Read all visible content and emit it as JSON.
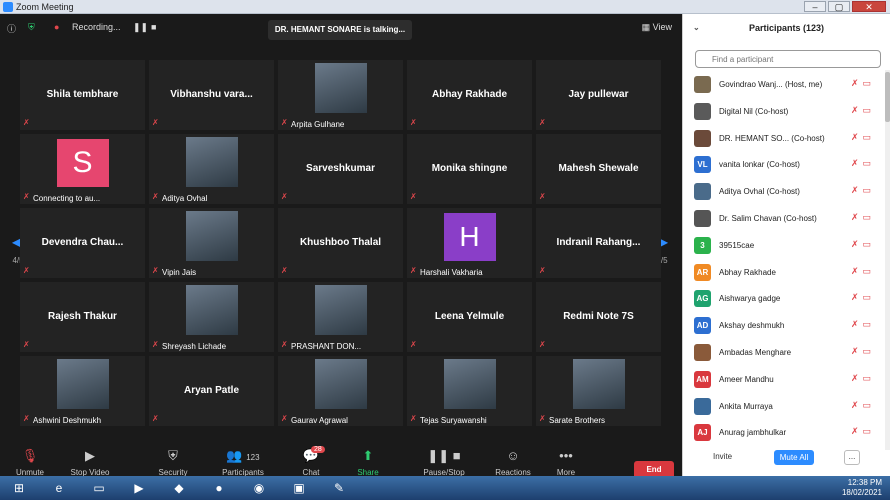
{
  "window": {
    "title": "Zoom Meeting"
  },
  "topbar": {
    "recording": "Recording...",
    "talking": "DR. HEMANT SONARE is talking...",
    "view": "View"
  },
  "grid": {
    "page_left": "4/5",
    "page_right": "4/5",
    "tiles": [
      {
        "name": "Shila tembhare"
      },
      {
        "name": "Vibhanshu  vara..."
      },
      {
        "caption": "Arpita Gulhane",
        "photo": true
      },
      {
        "name": "Abhay Rakhade"
      },
      {
        "name": "Jay pullewar"
      },
      {
        "caption": "Connecting to au...",
        "avatar": "S"
      },
      {
        "caption": "Aditya Ovhal",
        "photo": true
      },
      {
        "name": "Sarveshkumar"
      },
      {
        "name": "Monika shingne"
      },
      {
        "name": "Mahesh Shewale"
      },
      {
        "name": "Devendra  Chau..."
      },
      {
        "caption": "Vipin Jais",
        "photo": true
      },
      {
        "name": "Khushboo Thalal"
      },
      {
        "caption": "Harshali Vakharia",
        "avatar": "H"
      },
      {
        "name": "Indranil  Rahang..."
      },
      {
        "name": "Rajesh Thakur"
      },
      {
        "caption": "Shreyash Lichade",
        "photo": true
      },
      {
        "caption": "PRASHANT DON...",
        "photo": true
      },
      {
        "name": "Leena Yelmule"
      },
      {
        "name": "Redmi Note 7S"
      },
      {
        "caption": "Ashwini Deshmukh",
        "photo": true
      },
      {
        "name": "Aryan Patle"
      },
      {
        "caption": "Gaurav Agrawal",
        "photo": true
      },
      {
        "caption": "Tejas Suryawanshi",
        "photo": true
      },
      {
        "caption": "Sarate Brothers",
        "photo": true
      }
    ]
  },
  "toolbar": {
    "unmute": "Unmute",
    "stop_video": "Stop Video",
    "security": "Security",
    "participants": "Participants",
    "participants_count": "123",
    "chat": "Chat",
    "chat_badge": "28",
    "share": "Share Screen",
    "pause": "Pause/Stop Recording",
    "reactions": "Reactions",
    "more": "More",
    "end": "End"
  },
  "panel": {
    "title": "Participants (123)",
    "search_placeholder": "Find a participant",
    "participants": [
      {
        "name": "Govindrao Wanj...  (Host, me)",
        "initials": "",
        "color": "#7a6a50"
      },
      {
        "name": "Digital Nil (Co-host)",
        "initials": "",
        "color": "#5a5a5a"
      },
      {
        "name": "DR. HEMANT SO...  (Co-host)",
        "initials": "",
        "color": "#6b4a3a"
      },
      {
        "name": "vanita lonkar (Co-host)",
        "initials": "VL",
        "color": "#2d6fd1"
      },
      {
        "name": "Aditya Ovhal (Co-host)",
        "initials": "",
        "color": "#4a6b8a"
      },
      {
        "name": "Dr. Salim Chavan (Co-host)",
        "initials": "",
        "color": "#555555"
      },
      {
        "name": "39515cae",
        "initials": "3",
        "color": "#2bb24c"
      },
      {
        "name": "Abhay Rakhade",
        "initials": "AR",
        "color": "#f08a24"
      },
      {
        "name": "Aishwarya gadge",
        "initials": "AG",
        "color": "#1fa36e"
      },
      {
        "name": "Akshay deshmukh",
        "initials": "AD",
        "color": "#2d6fd1"
      },
      {
        "name": "Ambadas Menghare",
        "initials": "",
        "color": "#8a5a3a"
      },
      {
        "name": "Ameer Mandhu",
        "initials": "AM",
        "color": "#d9383e"
      },
      {
        "name": "Ankita Murraya",
        "initials": "",
        "color": "#3a6a9a"
      },
      {
        "name": "Anurag jambhulkar",
        "initials": "AJ",
        "color": "#d9383e"
      }
    ],
    "invite": "Invite",
    "mute_all": "Mute All",
    "more": "..."
  },
  "taskbar": {
    "time": "12:38 PM",
    "date": "18/02/2021"
  }
}
